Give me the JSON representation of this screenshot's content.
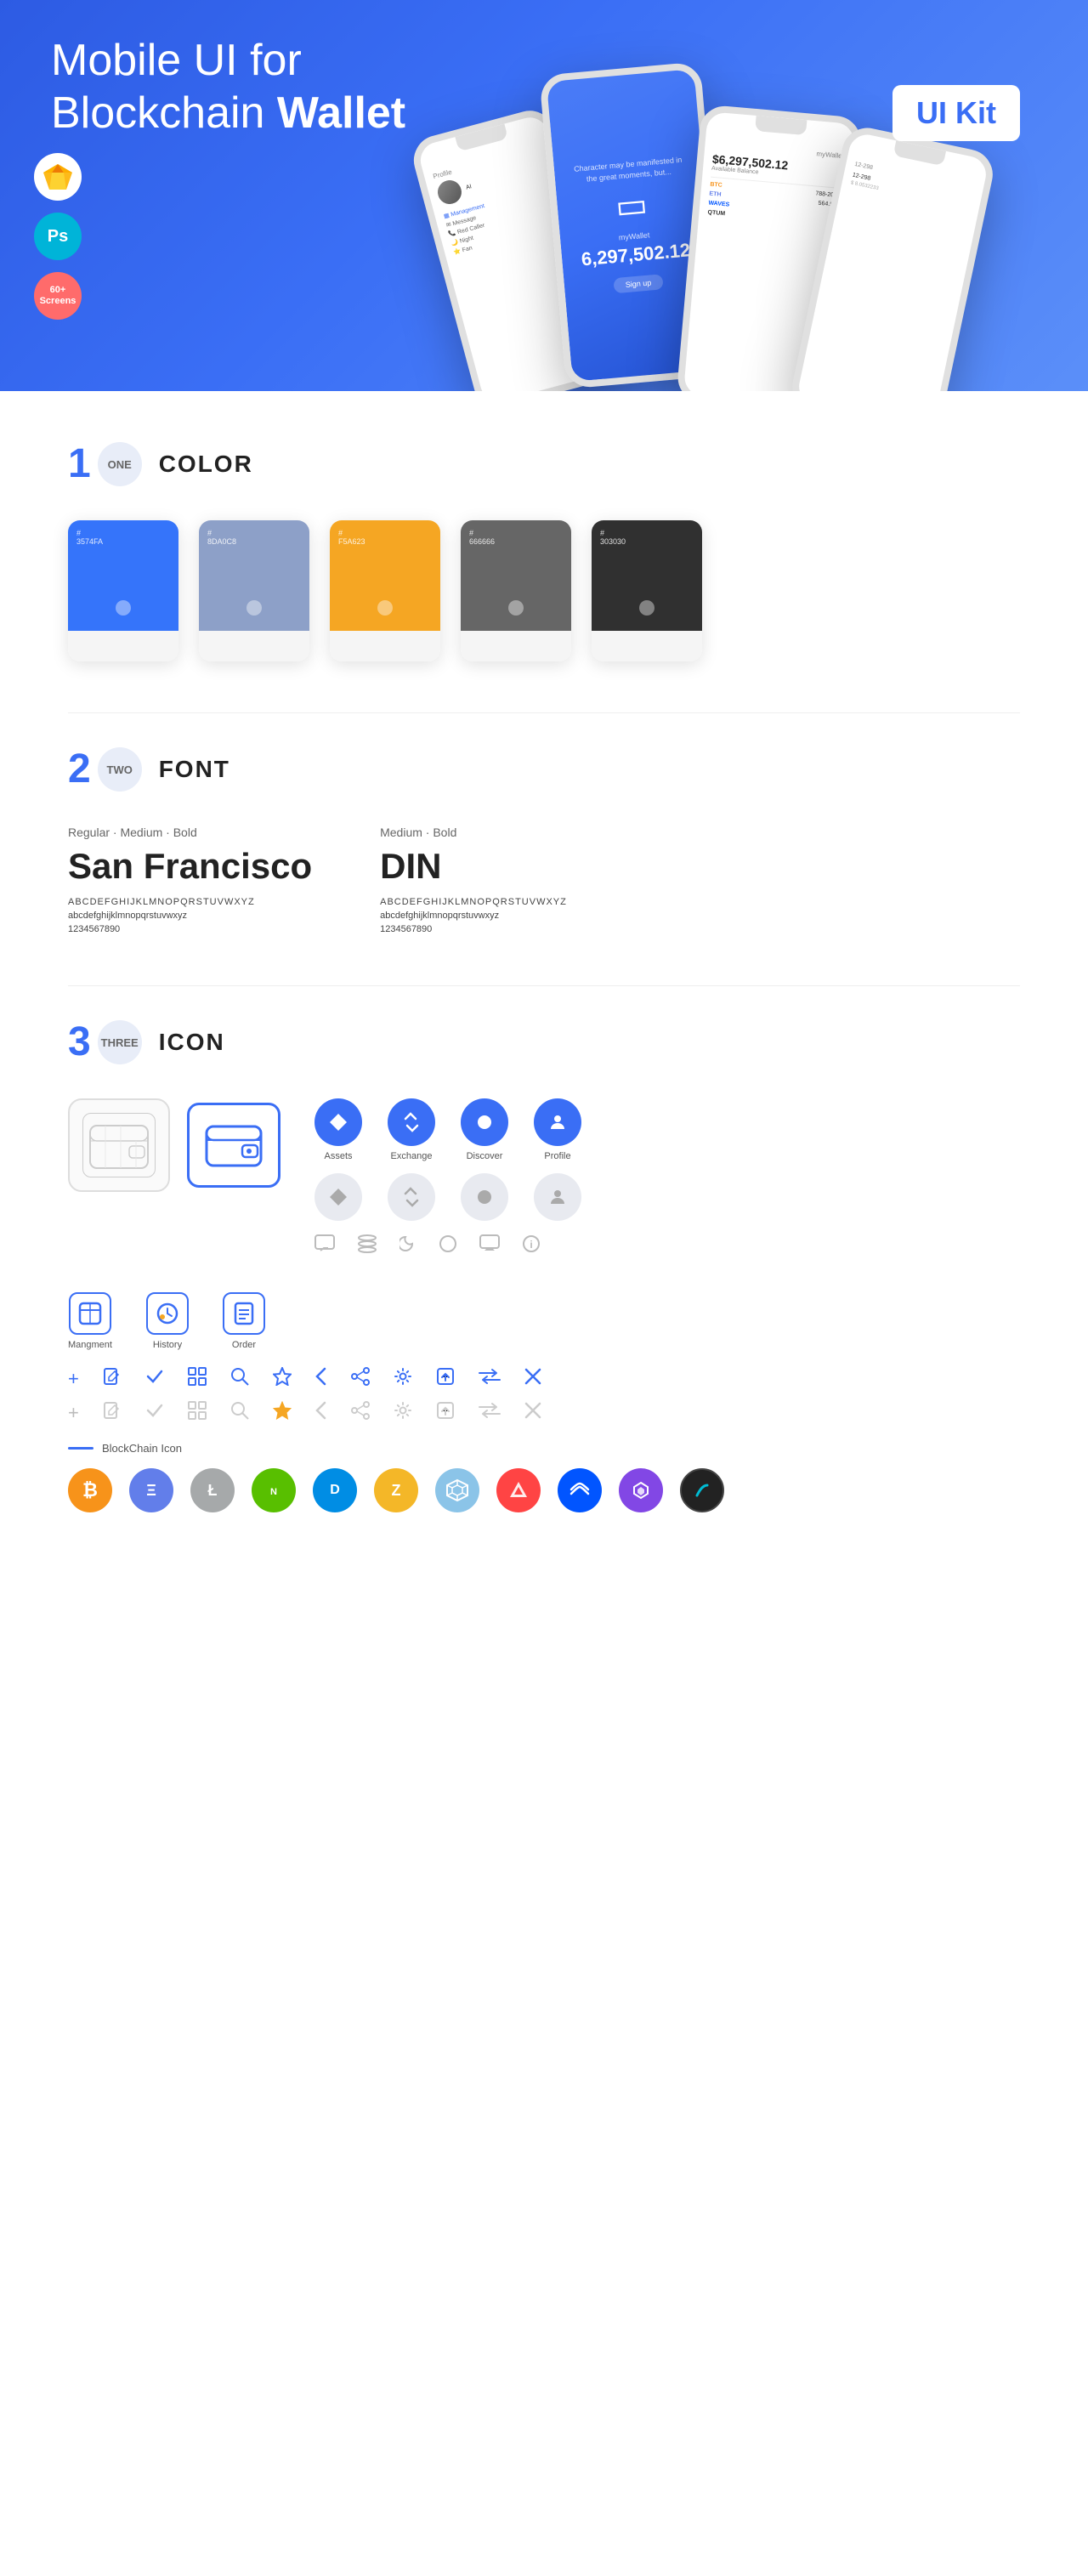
{
  "hero": {
    "title_regular": "Mobile UI for Blockchain ",
    "title_bold": "Wallet",
    "badge": "UI Kit",
    "tools": [
      {
        "name": "Sketch",
        "symbol": "🎨",
        "bg": "#fff"
      },
      {
        "name": "Photoshop",
        "symbol": "Ps",
        "bg": "#00b4d8"
      },
      {
        "name": "Screens",
        "symbol": "60+\nScreens",
        "bg": "#ff6b6b"
      }
    ]
  },
  "section1": {
    "number": "1",
    "badge_label": "ONE",
    "title": "COLOR",
    "colors": [
      {
        "hex": "#3574FA",
        "label": "3574FA"
      },
      {
        "hex": "#8DA0C8",
        "label": "8DA0C8"
      },
      {
        "hex": "#F5A623",
        "label": "F5A623"
      },
      {
        "hex": "#666666",
        "label": "666666"
      },
      {
        "hex": "#303030",
        "label": "303030"
      }
    ]
  },
  "section2": {
    "number": "2",
    "badge_label": "TWO",
    "title": "FONT",
    "fonts": [
      {
        "meta": "Regular · Medium · Bold",
        "name": "San Francisco",
        "upper": "ABCDEFGHIJKLMNOPQRSTUVWXYZ",
        "lower": "abcdefghijklmnopqrstuvwxyz",
        "nums": "1234567890"
      },
      {
        "meta": "Medium · Bold",
        "name": "DIN",
        "upper": "ABCDEFGHIJKLMNOPQRSTUVWXYZ",
        "lower": "abcdefghijklmnopqrstuvwxyz",
        "nums": "1234567890"
      }
    ]
  },
  "section3": {
    "number": "3",
    "badge_label": "THREE",
    "title": "ICON",
    "nav_icons": [
      {
        "label": "Assets",
        "symbol": "◆"
      },
      {
        "label": "Exchange",
        "symbol": "⇌"
      },
      {
        "label": "Discover",
        "symbol": "●"
      },
      {
        "label": "Profile",
        "symbol": "👤"
      }
    ],
    "mgmt_icons": [
      {
        "label": "Mangment",
        "symbol": "▦"
      },
      {
        "label": "History",
        "symbol": "🕐"
      },
      {
        "label": "Order",
        "symbol": "📋"
      }
    ],
    "blockchain_label": "BlockChain Icon",
    "cryptos": [
      {
        "name": "Bitcoin",
        "symbol": "₿",
        "class": "crypto-btc"
      },
      {
        "name": "Ethereum",
        "symbol": "Ξ",
        "class": "crypto-eth"
      },
      {
        "name": "Litecoin",
        "symbol": "Ł",
        "class": "crypto-ltc"
      },
      {
        "name": "NEO",
        "symbol": "N",
        "class": "crypto-neo"
      },
      {
        "name": "Dash",
        "symbol": "D",
        "class": "crypto-dash"
      },
      {
        "name": "Zcash",
        "symbol": "Z",
        "class": "crypto-zcash"
      },
      {
        "name": "Grid",
        "symbol": "⬡",
        "class": "crypto-grid"
      },
      {
        "name": "Ark",
        "symbol": "▲",
        "class": "crypto-ark"
      },
      {
        "name": "Waves",
        "symbol": "W",
        "class": "crypto-waves"
      },
      {
        "name": "Matic",
        "symbol": "M",
        "class": "crypto-matic"
      },
      {
        "name": "Stratis",
        "symbol": "S",
        "class": "crypto-stratis"
      }
    ]
  }
}
